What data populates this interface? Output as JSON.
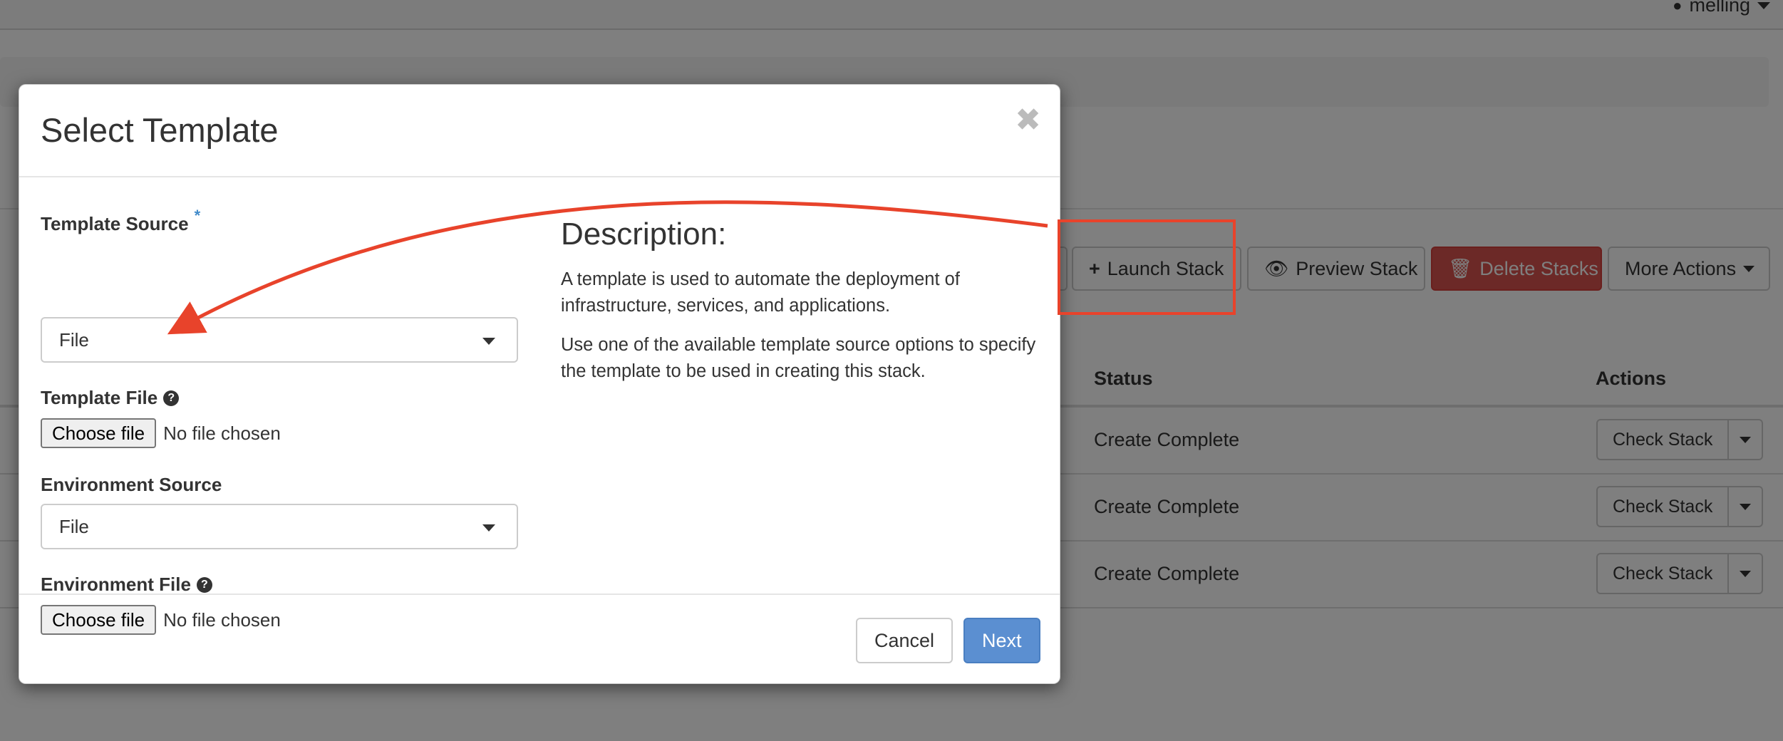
{
  "header": {
    "username": "melling"
  },
  "toolbar": {
    "launch_stack": "Launch Stack",
    "preview_stack": "Preview Stack",
    "delete_stacks": "Delete Stacks",
    "more_actions": "More Actions"
  },
  "table": {
    "columns": [
      "Status",
      "Actions"
    ],
    "rows": [
      {
        "status": "Create Complete",
        "action": "Check Stack"
      },
      {
        "status": "Create Complete",
        "action": "Check Stack"
      },
      {
        "status": "Create Complete",
        "action": "Check Stack"
      }
    ]
  },
  "modal": {
    "title": "Select Template",
    "close_symbol": "✖",
    "template_source": {
      "label": "Template Source",
      "required_mark": "*",
      "value": "File"
    },
    "template_file": {
      "label": "Template File",
      "button": "Choose file",
      "status": "No file chosen"
    },
    "environment_source": {
      "label": "Environment Source",
      "value": "File"
    },
    "environment_file": {
      "label": "Environment File",
      "button": "Choose file",
      "status": "No file chosen"
    },
    "help_symbol": "?",
    "description": {
      "title": "Description:",
      "paragraphs": [
        "A template is used to automate the deployment of infrastructure, services, and applications.",
        "Use one of the available template source options to specify the template to be used in creating this stack."
      ]
    },
    "cancel_label": "Cancel",
    "next_label": "Next"
  },
  "colors": {
    "annotation": "#e8432b",
    "primary": "#5b8fd1",
    "danger": "#d9534f"
  }
}
